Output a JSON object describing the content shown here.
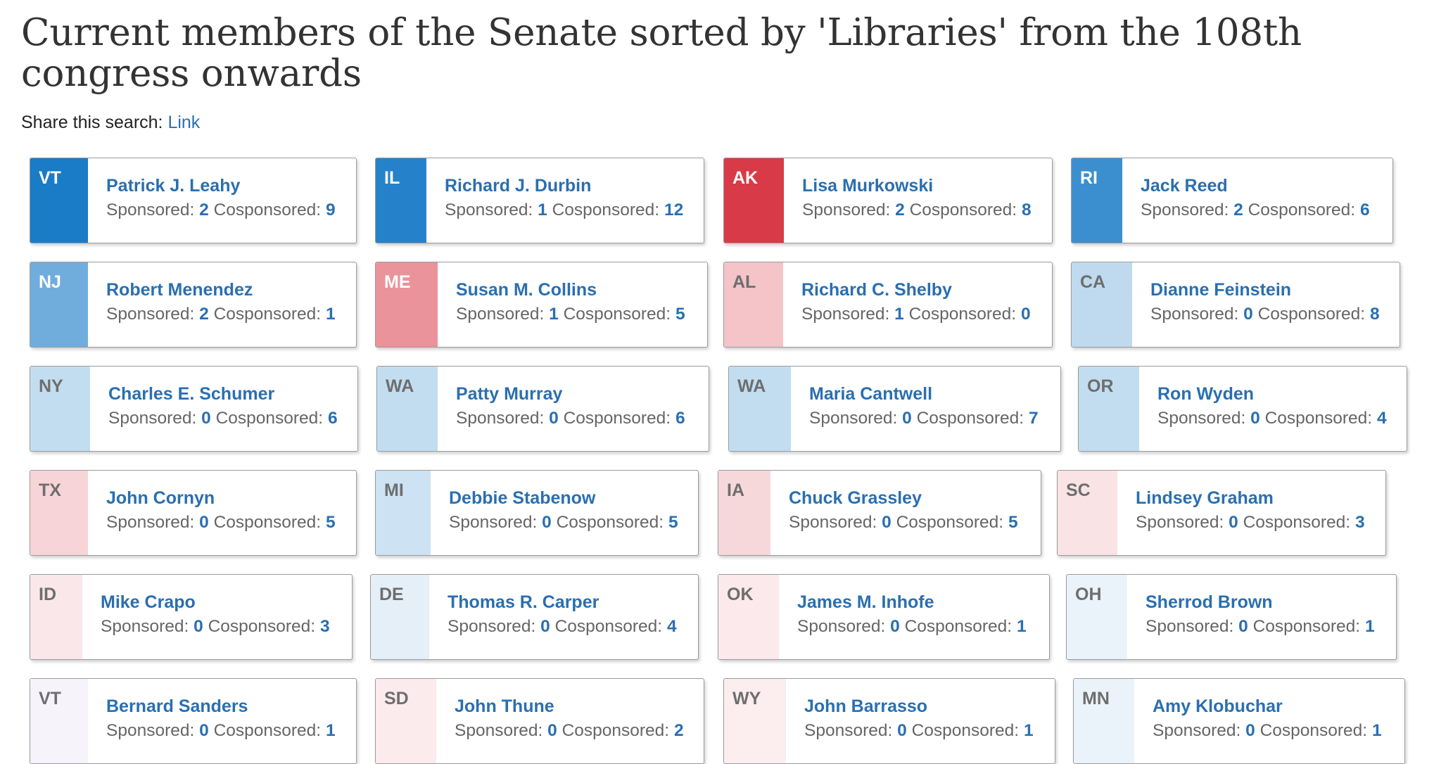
{
  "title": "Current members of the Senate sorted by 'Libraries' from the 108th congress onwards",
  "share": {
    "label": "Share this search: ",
    "link_text": "Link"
  },
  "sponsored_label": "Sponsored: ",
  "cosponsored_label": "Cosponsored: ",
  "party_colors": {
    "democrat": "#1a7bc7",
    "republican": "#d93a47",
    "independent": "#a78bd6"
  },
  "members": [
    {
      "state": "VT",
      "name": "Patrick J. Leahy",
      "sponsored": "2",
      "cosponsored": "9"
    },
    {
      "state": "IL",
      "name": "Richard J. Durbin",
      "sponsored": "1",
      "cosponsored": "12"
    },
    {
      "state": "AK",
      "name": "Lisa Murkowski",
      "sponsored": "2",
      "cosponsored": "8"
    },
    {
      "state": "RI",
      "name": "Jack Reed",
      "sponsored": "2",
      "cosponsored": "6"
    },
    {
      "state": "NJ",
      "name": "Robert Menendez",
      "sponsored": "2",
      "cosponsored": "1"
    },
    {
      "state": "ME",
      "name": "Susan M. Collins",
      "sponsored": "1",
      "cosponsored": "5"
    },
    {
      "state": "AL",
      "name": "Richard C. Shelby",
      "sponsored": "1",
      "cosponsored": "0"
    },
    {
      "state": "CA",
      "name": "Dianne Feinstein",
      "sponsored": "0",
      "cosponsored": "8"
    },
    {
      "state": "NY",
      "name": "Charles E. Schumer",
      "sponsored": "0",
      "cosponsored": "6"
    },
    {
      "state": "WA",
      "name": "Patty Murray",
      "sponsored": "0",
      "cosponsored": "6"
    },
    {
      "state": "WA",
      "name": "Maria Cantwell",
      "sponsored": "0",
      "cosponsored": "7"
    },
    {
      "state": "OR",
      "name": "Ron Wyden",
      "sponsored": "0",
      "cosponsored": "4"
    },
    {
      "state": "TX",
      "name": "John Cornyn",
      "sponsored": "0",
      "cosponsored": "5"
    },
    {
      "state": "MI",
      "name": "Debbie Stabenow",
      "sponsored": "0",
      "cosponsored": "5"
    },
    {
      "state": "IA",
      "name": "Chuck Grassley",
      "sponsored": "0",
      "cosponsored": "5"
    },
    {
      "state": "SC",
      "name": "Lindsey Graham",
      "sponsored": "0",
      "cosponsored": "3"
    },
    {
      "state": "ID",
      "name": "Mike Crapo",
      "sponsored": "0",
      "cosponsored": "3"
    },
    {
      "state": "DE",
      "name": "Thomas R. Carper",
      "sponsored": "0",
      "cosponsored": "4"
    },
    {
      "state": "OK",
      "name": "James M. Inhofe",
      "sponsored": "0",
      "cosponsored": "1"
    },
    {
      "state": "OH",
      "name": "Sherrod Brown",
      "sponsored": "0",
      "cosponsored": "1"
    },
    {
      "state": "VT",
      "name": "Bernard Sanders",
      "sponsored": "0",
      "cosponsored": "1"
    },
    {
      "state": "SD",
      "name": "John Thune",
      "sponsored": "0",
      "cosponsored": "2"
    },
    {
      "state": "WY",
      "name": "John Barrasso",
      "sponsored": "0",
      "cosponsored": "1"
    },
    {
      "state": "MN",
      "name": "Amy Klobuchar",
      "sponsored": "0",
      "cosponsored": "1"
    }
  ]
}
